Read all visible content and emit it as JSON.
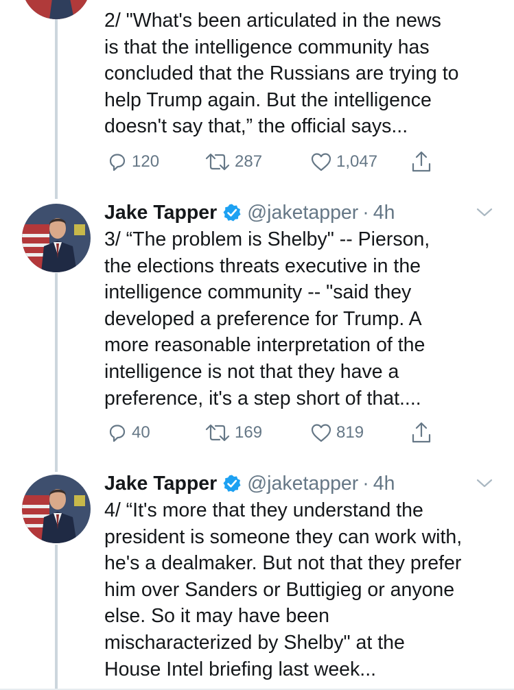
{
  "tweets": [
    {
      "text": "2/ \"What's been articulated in the news\nis that the intelligence community has\nconcluded that the Russians are trying to\nhelp Trump again. But the intelligence\ndoesn't say that,” the official says...",
      "replies": "120",
      "retweets": "287",
      "likes": "1,047"
    },
    {
      "name": "Jake Tapper",
      "handle": "@jaketapper",
      "separator": "·",
      "time": "4h",
      "text": "3/ “The problem is Shelby\" -- Pierson,\nthe elections threats executive in the\nintelligence community -- \"said they\ndeveloped a preference for Trump. A\nmore reasonable interpretation of the\nintelligence is not that they have a\npreference, it's a step short of that....",
      "replies": "40",
      "retweets": "169",
      "likes": "819"
    },
    {
      "name": "Jake Tapper",
      "handle": "@jaketapper",
      "separator": "·",
      "time": "4h",
      "text": "4/ “It's more that they understand the\npresident is someone they can work with,\nhe's a dealmaker. But not that they prefer\nhim over Sanders or Buttigieg or anyone\nelse. So it may have been\nmischaracterized by Shelby\" at the\nHouse Intel briefing last week..."
    }
  ],
  "icons": {
    "reply": "reply-icon",
    "retweet": "retweet-icon",
    "like": "like-icon",
    "share": "share-icon",
    "verified": "verified-badge-icon",
    "caret": "chevron-down-icon"
  },
  "colors": {
    "text": "#14171a",
    "secondary": "#657786",
    "verified": "#1da1f2",
    "thread_line": "#ccd6dd"
  }
}
